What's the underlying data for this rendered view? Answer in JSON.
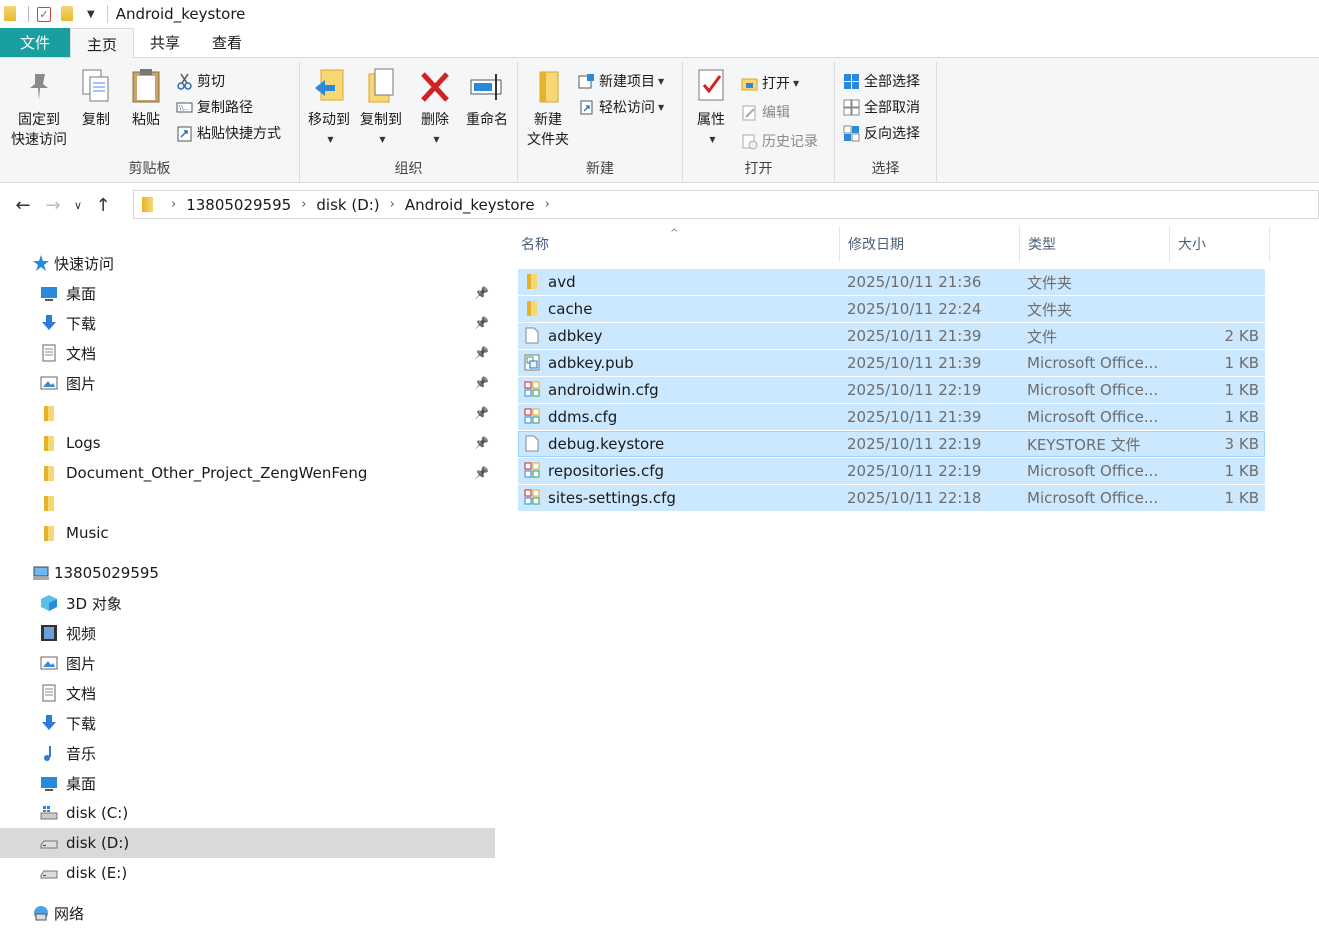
{
  "window": {
    "title": "Android_keystore"
  },
  "tabs": [
    "文件",
    "主页",
    "共享",
    "查看"
  ],
  "ribbon": {
    "clipboard": {
      "label": "剪贴板",
      "pin_line1": "固定到",
      "pin_line2": "快速访问",
      "copy": "复制",
      "paste": "粘贴",
      "cut": "剪切",
      "copy_path": "复制路径",
      "paste_shortcut": "粘贴快捷方式"
    },
    "organize": {
      "label": "组织",
      "move_to": "移动到",
      "copy_to": "复制到",
      "delete": "删除",
      "rename": "重命名"
    },
    "new": {
      "label": "新建",
      "new_folder_line1": "新建",
      "new_folder_line2": "文件夹",
      "new_item": "新建项目",
      "easy_access": "轻松访问"
    },
    "open": {
      "label": "打开",
      "properties": "属性",
      "open": "打开",
      "edit": "编辑",
      "history": "历史记录"
    },
    "select": {
      "label": "选择",
      "select_all": "全部选择",
      "select_none": "全部取消",
      "invert": "反向选择"
    }
  },
  "address": {
    "crumbs": [
      "13805029595",
      "disk (D:)",
      "Android_keystore"
    ]
  },
  "sidebar": {
    "quick_access": "快速访问",
    "quick_items": [
      {
        "label": "桌面",
        "icon": "desktop-icon"
      },
      {
        "label": "下载",
        "icon": "download-icon"
      },
      {
        "label": "文档",
        "icon": "document-icon"
      },
      {
        "label": "图片",
        "icon": "picture-icon"
      },
      {
        "label": "",
        "icon": "folder-icon"
      },
      {
        "label": "Logs",
        "icon": "folder-icon"
      },
      {
        "label": "Document_Other_Project_ZengWenFeng",
        "icon": "folder-icon"
      },
      {
        "label": "",
        "icon": "folder-icon"
      },
      {
        "label": "Music",
        "icon": "folder-icon"
      }
    ],
    "this_pc": "13805029595",
    "pc_items": [
      {
        "label": "3D 对象",
        "icon": "3d-objects-icon"
      },
      {
        "label": "视频",
        "icon": "video-icon"
      },
      {
        "label": "图片",
        "icon": "picture-icon"
      },
      {
        "label": "文档",
        "icon": "document-icon"
      },
      {
        "label": "下载",
        "icon": "download-icon"
      },
      {
        "label": "音乐",
        "icon": "music-icon"
      },
      {
        "label": "桌面",
        "icon": "desktop-icon"
      },
      {
        "label": "disk (C:)",
        "icon": "system-drive-icon"
      },
      {
        "label": "disk (D:)",
        "icon": "drive-icon"
      },
      {
        "label": "disk (E:)",
        "icon": "drive-icon"
      }
    ],
    "network": "网络"
  },
  "columns": {
    "name": "名称",
    "modified": "修改日期",
    "type": "类型",
    "size": "大小"
  },
  "files": [
    {
      "name": "avd",
      "date": "2025/10/11 21:36",
      "type": "文件夹",
      "size": "",
      "icon": "folder"
    },
    {
      "name": "cache",
      "date": "2025/10/11 22:24",
      "type": "文件夹",
      "size": "",
      "icon": "folder"
    },
    {
      "name": "adbkey",
      "date": "2025/10/11 21:39",
      "type": "文件",
      "size": "2 KB",
      "icon": "file"
    },
    {
      "name": "adbkey.pub",
      "date": "2025/10/11 21:39",
      "type": "Microsoft Office...",
      "size": "1 KB",
      "icon": "pub"
    },
    {
      "name": "androidwin.cfg",
      "date": "2025/10/11 22:19",
      "type": "Microsoft Office...",
      "size": "1 KB",
      "icon": "cfg"
    },
    {
      "name": "ddms.cfg",
      "date": "2025/10/11 21:39",
      "type": "Microsoft Office...",
      "size": "1 KB",
      "icon": "cfg"
    },
    {
      "name": "debug.keystore",
      "date": "2025/10/11 22:19",
      "type": "KEYSTORE 文件",
      "size": "3 KB",
      "icon": "file"
    },
    {
      "name": "repositories.cfg",
      "date": "2025/10/11 22:19",
      "type": "Microsoft Office...",
      "size": "1 KB",
      "icon": "cfg"
    },
    {
      "name": "sites-settings.cfg",
      "date": "2025/10/11 22:18",
      "type": "Microsoft Office...",
      "size": "1 KB",
      "icon": "cfg"
    }
  ],
  "colors": {
    "file_tab": "#1a9fa0",
    "selection": "#cce8ff",
    "sidebar_selected": "#d9d9d9"
  }
}
